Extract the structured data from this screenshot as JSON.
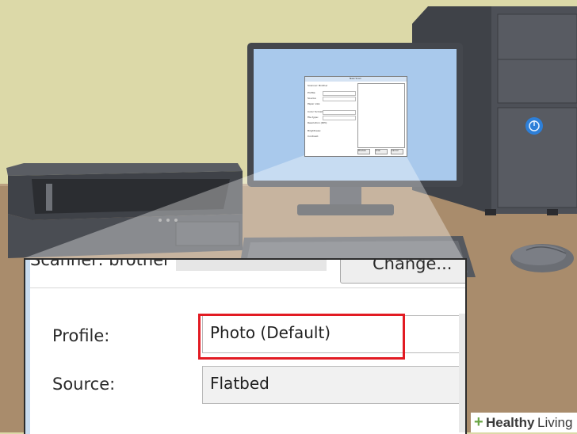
{
  "zoom_dialog": {
    "scanner_label": "Scanner: brother",
    "change_button": "Change...",
    "profile_label": "Profile:",
    "profile_value": "Photo (Default)",
    "source_label": "Source:",
    "source_value": "Flatbed",
    "highlight_color": "#e21b23"
  },
  "mini_dialog": {
    "title": "New Scan",
    "rows": [
      "Scanner: Brother",
      "Profile:",
      "Source:",
      "Paper size:",
      "Color format:",
      "File type:",
      "Resolution (DPI):",
      "Brightness:",
      "Contrast:"
    ],
    "buttons": [
      "Preview",
      "Scan",
      "Cancel"
    ]
  },
  "watermark": {
    "plus": "+",
    "brand": "Healthy",
    "brand2": "Living",
    "accent_color": "#6aa545"
  },
  "colors": {
    "wall": "#dcd9a8",
    "desk": "#a98c6c",
    "screen": "#a9c9ec",
    "device_dark": "#4b4e55"
  }
}
